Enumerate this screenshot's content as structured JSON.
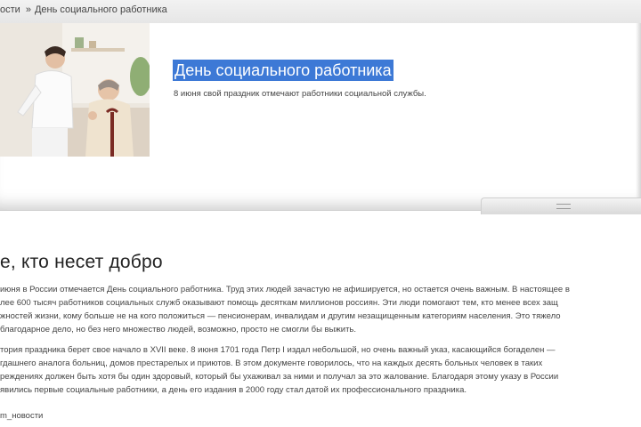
{
  "breadcrumb": {
    "items": [
      "ости",
      "День социального работника"
    ],
    "separator": "»"
  },
  "hero": {
    "title": "День социального работника",
    "subtitle": "8 июня свой праздник отмечают работники социальной службы.",
    "selection_color": "#3d79d6"
  },
  "article": {
    "title": "е, кто несет добро",
    "paragraph1": [
      "июня в России отмечается День социального работника. Труд этих людей зачастую не афишируется, но остается очень важным. В настоящее в",
      "лее 600 тысяч работников социальных служб оказывают помощь десяткам миллионов россиян. Эти люди помогают тем, кто менее всех защ",
      "жностей жизни, кому больше не на кого положиться — пенсионерам, инвалидам и другим незащищенным категориям населения. Это тяжело",
      "благодарное дело, но без него множество людей, возможно, просто не смогли бы выжить."
    ],
    "paragraph2": [
      "тория праздника берет свое начало в XVII веке. 8 июня 1701 года Петр I издал небольшой, но очень важный указ, касающийся богаделен —",
      "гдашнего аналога больниц, домов престарелых и приютов. В этом документе говорилось, что на каждых десять больных человек в таких",
      "реждениях должен быть хотя бы один здоровый, который бы ухаживал за ними и получал за это жалование.  Благодаря этому указу в России",
      "явились первые социальные работники, а день его издания в 2000 году стал датой их профессионального праздника."
    ],
    "tag": "m_новости"
  },
  "icons": {
    "photo": "caregiver-with-elderly-woman-photo",
    "slider": "slider-grip-icon"
  }
}
